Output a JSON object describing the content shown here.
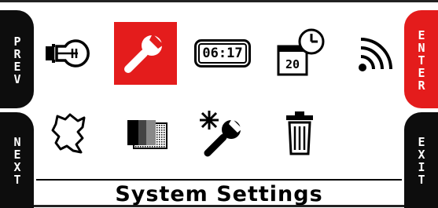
{
  "side_buttons": {
    "prev": "PREV",
    "next": "NEXT",
    "enter": "ENTER",
    "exit": "EXIT"
  },
  "colors": {
    "accent": "#e41c1c",
    "tab_dark": "#0d0d0d",
    "background": "#ffffff"
  },
  "menu": {
    "selected_index": 1,
    "items": [
      {
        "icon": "lightbulb-icon"
      },
      {
        "icon": "wrench-icon"
      },
      {
        "icon": "clock-display-icon",
        "text": "06:17"
      },
      {
        "icon": "calendar-clock-icon",
        "text": "20"
      },
      {
        "icon": "wireless-signal-icon"
      },
      {
        "icon": "map-region-icon"
      },
      {
        "icon": "contrast-icon"
      },
      {
        "icon": "reset-settings-icon"
      },
      {
        "icon": "trash-icon"
      }
    ]
  },
  "title": "System Settings"
}
